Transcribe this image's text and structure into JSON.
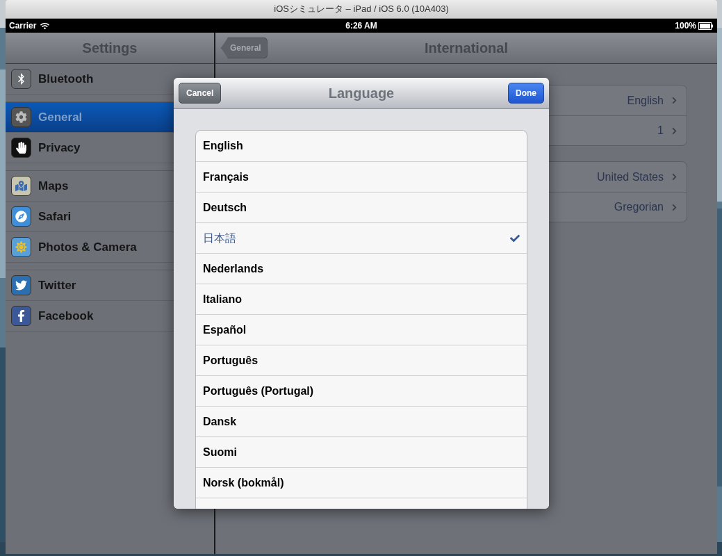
{
  "window": {
    "title": "iOSシミュレータ – iPad / iOS 6.0 (10A403)"
  },
  "status_bar": {
    "carrier": "Carrier",
    "time": "6:26 AM",
    "battery": "100%"
  },
  "sidebar": {
    "title": "Settings",
    "groups": [
      {
        "items": [
          {
            "label": "Bluetooth",
            "selected": false
          }
        ]
      },
      {
        "items": [
          {
            "label": "General",
            "selected": true
          },
          {
            "label": "Privacy",
            "selected": false
          }
        ]
      },
      {
        "items": [
          {
            "label": "Maps",
            "selected": false
          },
          {
            "label": "Safari",
            "selected": false
          },
          {
            "label": "Photos & Camera",
            "selected": false
          }
        ]
      },
      {
        "items": [
          {
            "label": "Twitter",
            "selected": false
          },
          {
            "label": "Facebook",
            "selected": false
          }
        ]
      }
    ]
  },
  "detail": {
    "back_button": "General",
    "title": "International",
    "groups": [
      {
        "rows": [
          {
            "value": "English"
          },
          {
            "value": "1"
          }
        ]
      },
      {
        "rows": [
          {
            "value": "United States"
          },
          {
            "value": "Gregorian"
          }
        ]
      }
    ]
  },
  "modal": {
    "title": "Language",
    "cancel": "Cancel",
    "done": "Done",
    "languages": [
      {
        "label": "English",
        "selected": false
      },
      {
        "label": "Français",
        "selected": false
      },
      {
        "label": "Deutsch",
        "selected": false
      },
      {
        "label": "日本語",
        "selected": true
      },
      {
        "label": "Nederlands",
        "selected": false
      },
      {
        "label": "Italiano",
        "selected": false
      },
      {
        "label": "Español",
        "selected": false
      },
      {
        "label": "Português",
        "selected": false
      },
      {
        "label": "Português (Portugal)",
        "selected": false
      },
      {
        "label": "Dansk",
        "selected": false
      },
      {
        "label": "Suomi",
        "selected": false
      },
      {
        "label": "Norsk (bokmål)",
        "selected": false
      }
    ]
  }
}
